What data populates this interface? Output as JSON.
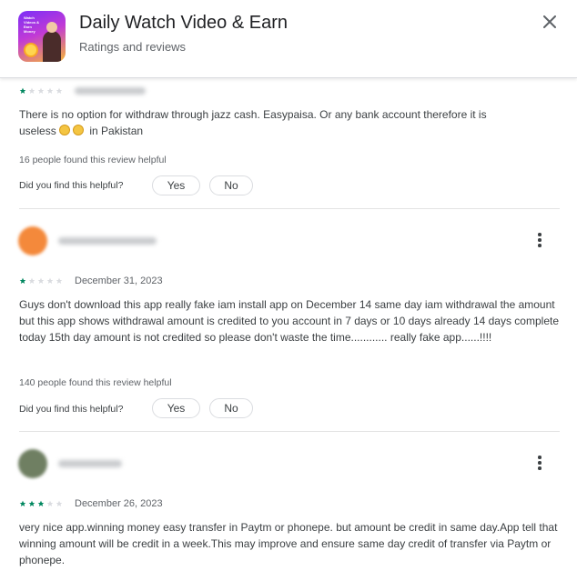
{
  "header": {
    "app_title": "Daily Watch Video & Earn",
    "subtitle": "Ratings and reviews",
    "icon_text": "Watch Videos & Earn Money"
  },
  "colors": {
    "star_filled": "#01875f",
    "star_empty": "#dadce0",
    "divider": "#e3e3e3"
  },
  "reviews": [
    {
      "rating": 1,
      "date": "",
      "body_line1": "There is no option for withdraw through jazz cash. Easypaisa. Or any bank account therefore it is",
      "body_line2_start": "useless",
      "emojis": [
        "disappointed-face-emoji",
        "disappointed-face-emoji"
      ],
      "body_line2_end": "in Pakistan",
      "helpful_count": "16 people found this review helpful",
      "helpful_question": "Did you find this helpful?",
      "yes_label": "Yes",
      "no_label": "No"
    },
    {
      "rating": 1,
      "date": "December 31, 2023",
      "body": "Guys don't download this app really fake iam install app on December 14 same day iam withdrawal the amount but this app shows withdrawal amount is credited to you account in 7 days or 10 days already 14 days complete today 15th day amount is not credited so please don't waste the time............ really fake app......!!!!",
      "helpful_count": "140 people found this review helpful",
      "helpful_question": "Did you find this helpful?",
      "yes_label": "Yes",
      "no_label": "No"
    },
    {
      "rating": 3,
      "date": "December 26, 2023",
      "body": "very nice app.winning money easy transfer in Paytm or phonepe. but amount be credit in same day.App tell that winning amount will be credit in a week.This may improve and ensure same day credit of transfer via Paytm or phonepe."
    }
  ]
}
